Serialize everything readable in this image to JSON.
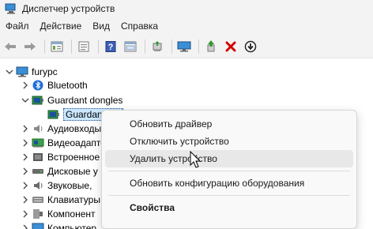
{
  "window": {
    "title": "Диспетчер устройств"
  },
  "menubar": [
    "Файл",
    "Действие",
    "Вид",
    "Справка"
  ],
  "toolbar": {
    "buttons": [
      "back-icon",
      "forward-icon",
      "properties-icon",
      "show-hide-icon",
      "help-icon",
      "properties-sheet-icon",
      "update-driver-icon",
      "scan-hardware-icon",
      "enable-device-icon",
      "remove-device-icon",
      "disable-device-icon"
    ]
  },
  "tree": {
    "root": "furypc",
    "items": [
      {
        "label": "Bluetooth",
        "expanded": false,
        "icon": "bluetooth-icon"
      },
      {
        "label": "Guardant dongles",
        "expanded": true,
        "icon": "dongle-icon"
      },
      {
        "label": "Guardant CP",
        "child": true,
        "selected": true,
        "icon": "dongle-icon"
      },
      {
        "label": "Аудиовходы",
        "expanded": false,
        "icon": "audio-icon"
      },
      {
        "label": "Видеоадапте",
        "expanded": false,
        "icon": "display-adapter-icon"
      },
      {
        "label": "Встроенное",
        "expanded": false,
        "icon": "firmware-icon"
      },
      {
        "label": "Дисковые у",
        "expanded": false,
        "icon": "disk-icon"
      },
      {
        "label": "Звуковые, ",
        "expanded": false,
        "icon": "sound-icon"
      },
      {
        "label": "Клавиатуры",
        "expanded": false,
        "icon": "keyboard-icon"
      },
      {
        "label": "Компонент",
        "expanded": false,
        "icon": "component-icon"
      },
      {
        "label": "Компьютер",
        "expanded": false,
        "icon": "computer-icon"
      }
    ]
  },
  "context_menu": {
    "items": [
      {
        "label": "Обновить драйвер"
      },
      {
        "label": "Отключить устройство"
      },
      {
        "label": "Удалить устройство",
        "hover": true
      },
      {
        "label": "Обновить конфигурацию оборудования"
      },
      {
        "label": "Свойства",
        "bold": true
      }
    ]
  },
  "colors": {
    "selection": "#cce8ff",
    "remove_red": "#d40000",
    "bluetooth_blue": "#1e6fd9"
  }
}
